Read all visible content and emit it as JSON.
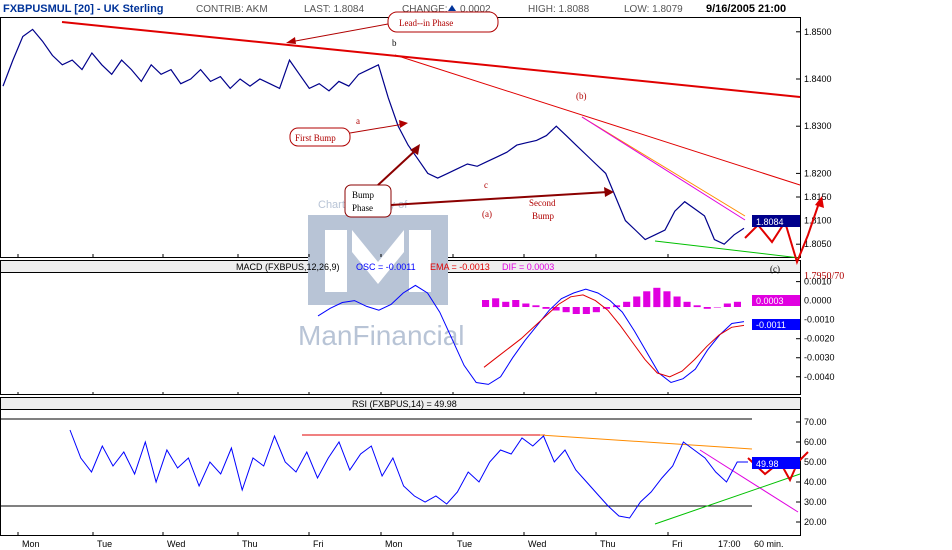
{
  "header": {
    "symbol": "FXBPUSMUL [20] - UK Sterling",
    "contrib": "CONTRIB: AKM",
    "last": "LAST: 1.8084",
    "change_label": "CHANGE:",
    "change_value": "0.0002",
    "high": "HIGH: 1.8088",
    "low": "LOW: 1.8079",
    "datetime": "9/16/2005 21:00"
  },
  "watermark": {
    "top": "Charts courtesy of",
    "brand": "ManFinancial"
  },
  "colors": {
    "price": "#00008b",
    "trend_red": "#e00000",
    "green": "#00c000",
    "orange": "#ff8c00",
    "magenta": "#e000e0",
    "macd_line": "#0000ff",
    "ema_line": "#e00000"
  },
  "price_panel": {
    "y_ticks": [
      "1.8500",
      "1.8400",
      "1.8300",
      "1.8200",
      "1.8150",
      "1.8100",
      "1.8050"
    ],
    "y_tick_values": [
      1.85,
      1.84,
      1.83,
      1.82,
      1.815,
      1.81,
      1.805
    ],
    "last_box": "1.8084",
    "target_label": "1.7950/70"
  },
  "annotations": {
    "lead_in": "Lead--in  Phase",
    "first_bump": "First Bump",
    "bump_phase_1": "Bump",
    "bump_phase_2": "Phase",
    "second_bump_1": "Second",
    "second_bump_2": "Bump",
    "a_lower": "a",
    "b_lower": "b",
    "c_lower": "c",
    "a_paren": "(a)",
    "b_paren": "(b)",
    "c_paren": "(c)"
  },
  "macd_panel": {
    "title_prefix": "MACD (FXBPUS,12,26,9)",
    "osc": "OSC = -0.0011",
    "ema": "EMA = -0.0013",
    "dif": "DIF = 0.0003",
    "y_ticks": [
      "0.0010",
      "0.0000",
      "-0.0010",
      "-0.0020",
      "-0.0030",
      "-0.0040"
    ],
    "box_dif": "0.0003",
    "box_osc": "-0.0011"
  },
  "rsi_panel": {
    "title": "RSI (FXBPUS,14) = 49.98",
    "y_ticks": [
      "70.00",
      "60.00",
      "50.00",
      "40.00",
      "30.00",
      "20.00"
    ],
    "box": "49.98"
  },
  "x_axis": {
    "labels": [
      "Mon",
      "Tue",
      "Wed",
      "Thu",
      "Fri",
      "Mon",
      "Tue",
      "Wed",
      "Thu",
      "Fri",
      "17:00",
      "60 min."
    ]
  },
  "chart_data": [
    {
      "type": "line",
      "title": "FXBPUSMUL [20] - UK Sterling",
      "xlabel": "",
      "ylabel": "",
      "x": [
        "Mon",
        "Tue",
        "Wed",
        "Thu",
        "Fri",
        "Mon",
        "Tue",
        "Wed",
        "Thu",
        "Fri"
      ],
      "ylim": [
        1.8025,
        1.8525
      ],
      "series": [
        {
          "values": [
            1.8385,
            1.844,
            1.849,
            1.8505,
            1.848,
            1.845,
            1.843,
            1.844,
            1.842,
            1.8455,
            1.843,
            1.841,
            1.844,
            1.842,
            1.8395,
            1.843,
            1.841,
            1.842,
            1.839,
            1.84,
            1.842,
            1.8395,
            1.8405,
            1.838,
            1.84,
            1.8385,
            1.84,
            1.839,
            1.838,
            1.844,
            1.841,
            1.838,
            1.839,
            1.8375,
            1.8395,
            1.8385,
            1.841,
            1.842,
            1.843,
            1.836,
            1.83,
            1.826,
            1.823,
            1.82,
            1.819,
            1.82,
            1.821,
            1.822,
            1.8215,
            1.8225,
            1.8235,
            1.8245,
            1.826,
            1.8265,
            1.827,
            1.828,
            1.83,
            1.828,
            1.826,
            1.824,
            1.822,
            1.82,
            1.815,
            1.81,
            1.808,
            1.806,
            1.807,
            1.808,
            1.812,
            1.814,
            1.8125,
            1.811,
            1.806,
            1.805,
            1.807,
            1.8084
          ]
        }
      ]
    },
    {
      "type": "line",
      "title": "MACD (FXBPUS,12,26,9)",
      "ylim": [
        -0.0048,
        0.0014
      ],
      "series": [
        {
          "name": "OSC",
          "values": [
            -0.0008,
            -0.0004,
            -0.0001,
            0.0,
            -0.0003,
            -0.0005,
            -0.0002,
            0.0004,
            0.0008,
            0.0004,
            -0.0006,
            -0.002,
            -0.0034,
            -0.0043,
            -0.0044,
            -0.004,
            -0.003,
            -0.0021,
            -0.0013,
            -0.0005,
            0.0001,
            0.0004,
            0.0006,
            0.0004,
            0.0,
            -0.0006,
            -0.0016,
            -0.0027,
            -0.0038,
            -0.0043,
            -0.0041,
            -0.0036,
            -0.0026,
            -0.0018,
            -0.0012,
            -0.0011
          ]
        },
        {
          "name": "EMA",
          "values": [
            -0.0035,
            -0.003,
            -0.0025,
            -0.002,
            -0.0014,
            -0.0008,
            -0.0002,
            0.0002,
            0.0003,
            0.0,
            -0.0005,
            -0.0013,
            -0.0022,
            -0.0031,
            -0.0038,
            -0.004,
            -0.0037,
            -0.0031,
            -0.0024,
            -0.0018,
            -0.0014,
            -0.0013
          ]
        },
        {
          "name": "DIF",
          "values": [
            0.0004,
            0.0005,
            0.0003,
            0.0004,
            0.0002,
            0.0001,
            -0.0001,
            -0.0002,
            -0.0003,
            -0.0004,
            -0.0004,
            -0.0003,
            -0.0001,
            0.0001,
            0.0003,
            0.0006,
            0.0009,
            0.0011,
            0.0009,
            0.0006,
            0.0003,
            0.0001,
            -0.0001,
            0.0,
            0.0002,
            0.0003
          ]
        }
      ]
    },
    {
      "type": "line",
      "title": "RSI (FXBPUS,14) = 49.98",
      "ylim": [
        15,
        75
      ],
      "series": [
        {
          "values": [
            66,
            52,
            45,
            58,
            48,
            55,
            44,
            60,
            40,
            56,
            47,
            52,
            38,
            50,
            44,
            57,
            36,
            52,
            48,
            63,
            50,
            45,
            55,
            42,
            52,
            60,
            46,
            54,
            58,
            43,
            52,
            38,
            33,
            30,
            33,
            29,
            35,
            45,
            40,
            50,
            56,
            54,
            62,
            58,
            63,
            50,
            56,
            46,
            40,
            34,
            28,
            23,
            22,
            30,
            35,
            42,
            48,
            60,
            56,
            52,
            45,
            40,
            50,
            49.98
          ]
        }
      ]
    }
  ]
}
